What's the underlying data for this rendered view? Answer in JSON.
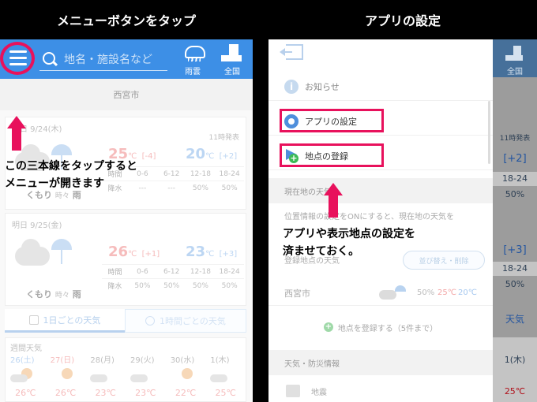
{
  "captions": {
    "left": "メニューボタンをタップ",
    "right": "アプリの設定"
  },
  "left_screen": {
    "search_placeholder": "地名・施設名など",
    "rain_label": "雨雲",
    "national_label": "全国",
    "city": "西宮市",
    "days": [
      {
        "date": "今日 9/24(木)",
        "published": "11時発表",
        "weather": "くもり",
        "weather_sub": "時々",
        "weather_tail": "雨",
        "high": "25",
        "high_diff": "[-4]",
        "low": "20",
        "low_diff": "[+2]",
        "time_label": "時間",
        "times": [
          "0-6",
          "6-12",
          "12-18",
          "18-24"
        ],
        "rain_row_label": "降水",
        "rain": [
          "---",
          "---",
          "50%",
          "50%"
        ]
      },
      {
        "date": "明日 9/25(金)",
        "published": "",
        "weather": "くもり",
        "weather_sub": "時々",
        "weather_tail": "雨",
        "high": "26",
        "high_diff": "[+1]",
        "low": "23",
        "low_diff": "[+3]",
        "time_label": "時間",
        "times": [
          "0-6",
          "6-12",
          "12-18",
          "18-24"
        ],
        "rain_row_label": "降水",
        "rain": [
          "50%",
          "50%",
          "50%",
          "50%"
        ]
      }
    ],
    "unit": "℃",
    "tabs": {
      "daily": "1日ごとの天気",
      "hourly": "1時間ごとの天気"
    },
    "weekly": {
      "title": "週間天気",
      "days": [
        {
          "label": "26",
          "dow": "(土)",
          "kind": "sat",
          "icon": "sun-cloud",
          "temp": "26"
        },
        {
          "label": "27",
          "dow": "(日)",
          "kind": "sun",
          "icon": "sun",
          "temp": "26"
        },
        {
          "label": "28",
          "dow": "(月)",
          "kind": "",
          "icon": "cloud",
          "temp": "23"
        },
        {
          "label": "29",
          "dow": "(火)",
          "kind": "",
          "icon": "cloud",
          "temp": "23"
        },
        {
          "label": "30",
          "dow": "(水)",
          "kind": "",
          "icon": "sun",
          "temp": "22"
        },
        {
          "label": "1",
          "dow": "(木)",
          "kind": "",
          "icon": "cloud",
          "temp": "25"
        }
      ]
    },
    "annotation": "この三本線をタップすると\nメニューが開きます"
  },
  "right_screen": {
    "menu_items": {
      "notice": "お知らせ",
      "app_settings": "アプリの設定",
      "register_location": "地点の登録"
    },
    "current_location_head": "現在地の天気",
    "location_text": "位置情報の設定をONにすると、現在地の天気を",
    "registered_head": "登録地点の天気",
    "sort_button": "並び替え・削除",
    "registered_location": {
      "name": "西宮市",
      "pop": "50%",
      "high": "25℃",
      "low": "20℃"
    },
    "add_location": "地点を登録する（5件まで）",
    "disaster_head": "天気・防災情報",
    "earthquake": "地震",
    "bg": {
      "national": "全国",
      "published": "11時発表",
      "diff": "[+2]",
      "slot": "18-24",
      "pop": "50%",
      "diff2": "[+3]",
      "slot2": "18-24",
      "pop2": "50%",
      "tab": "天気",
      "week_day": "1(木)",
      "temp": "25℃"
    },
    "annotation": "アプリや表示地点の設定を\n済ませておく。"
  },
  "colors": {
    "header_blue": "#3d8fe6",
    "highlight": "#e8115c",
    "high_temp": "#f3a6a6",
    "low_temp": "#a6c8ef"
  }
}
